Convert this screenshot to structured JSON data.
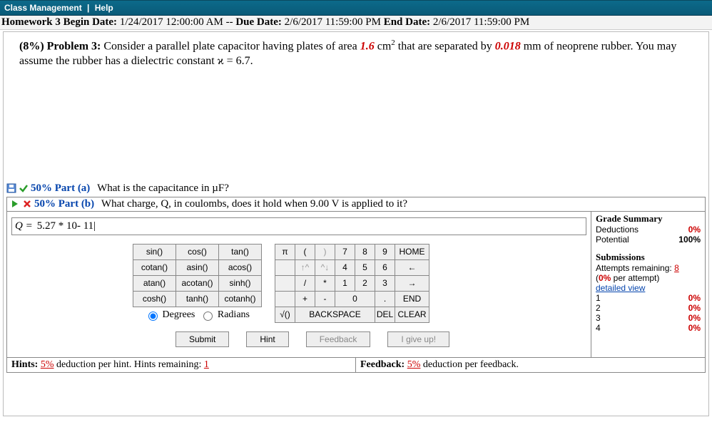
{
  "topbar": {
    "class_mgmt": "Class Management",
    "sep": "|",
    "help": "Help"
  },
  "hw": {
    "label_begin": "Homework 3 Begin Date:",
    "begin": "1/24/2017 12:00:00 AM",
    "sep": "--",
    "label_due": "Due Date:",
    "due": "2/6/2017 11:59:00 PM",
    "label_end": "End Date:",
    "end": "2/6/2017 11:59:00 PM"
  },
  "problem": {
    "pct": "(8%)",
    "label": "Problem 3:",
    "text1": "Consider a parallel plate capacitor having plates of area ",
    "area": "1.6",
    "text2": " cm",
    "text3": " that are separated by ",
    "dist": "0.018",
    "text4": " mm of neoprene rubber. You may assume the rubber has a dielectric constant ϰ = 6.7."
  },
  "part_a": {
    "pct": "50% Part (a)",
    "text": "What is the capacitance in µF?"
  },
  "part_b": {
    "pct": "50% Part (b)",
    "text": "What charge, Q, in coulombs, does it hold when 9.00 V is applied to it?"
  },
  "answer": {
    "var": "Q =",
    "value": "5.27 * 10- 11|"
  },
  "func_keys": [
    [
      "sin()",
      "cos()",
      "tan()"
    ],
    [
      "cotan()",
      "asin()",
      "acos()"
    ],
    [
      "atan()",
      "acotan()",
      "sinh()"
    ],
    [
      "cosh()",
      "tanh()",
      "cotanh()"
    ]
  ],
  "angle": {
    "deg": "Degrees",
    "rad": "Radians"
  },
  "numpad": {
    "r1": [
      "π",
      "(",
      ")",
      "7",
      "8",
      "9",
      "HOME"
    ],
    "r2": [
      "",
      "↑^",
      "^↓",
      "4",
      "5",
      "6",
      "←"
    ],
    "r3": [
      "",
      "/",
      "*",
      "1",
      "2",
      "3",
      "→"
    ],
    "r4": [
      "",
      "+",
      "-",
      "0",
      "",
      ".",
      "END"
    ],
    "r5": [
      "√()",
      "BACKSPACE",
      "",
      "DEL",
      "CLEAR"
    ]
  },
  "buttons": {
    "submit": "Submit",
    "hint": "Hint",
    "feedback": "Feedback",
    "giveup": "I give up!"
  },
  "hints": {
    "left1": "Hints:",
    "pct": "5%",
    "left2": "deduction per hint. Hints remaining:",
    "remain": "1"
  },
  "feedback": {
    "left": "Feedback:",
    "pct": "5%",
    "right": "deduction per feedback."
  },
  "grade": {
    "head": "Grade Summary",
    "ded_l": "Deductions",
    "ded_v": "0%",
    "pot_l": "Potential",
    "pot_v": "100%"
  },
  "subs": {
    "head": "Submissions",
    "rem_l": "Attempts remaining:",
    "rem_v": "8",
    "per_l": "(",
    "per_v": "0%",
    "per_r": " per attempt)",
    "detail": "detailed view",
    "rows": [
      [
        "1",
        "0%"
      ],
      [
        "2",
        "0%"
      ],
      [
        "3",
        "0%"
      ],
      [
        "4",
        "0%"
      ]
    ]
  }
}
